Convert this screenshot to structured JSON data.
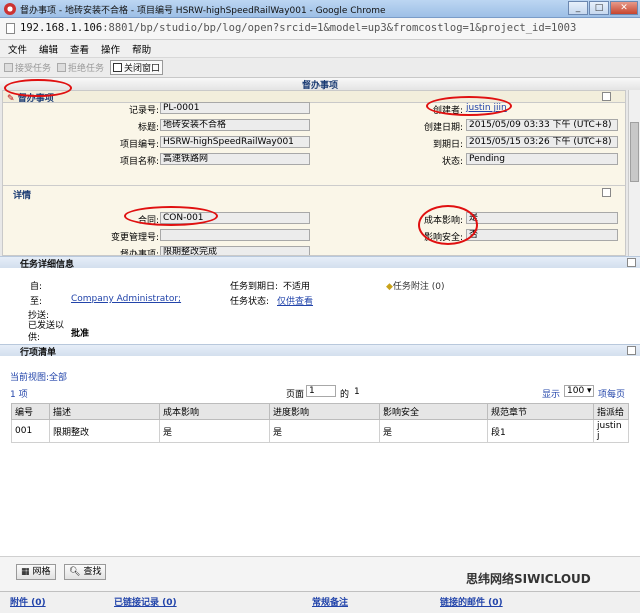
{
  "window": {
    "title": "督办事项 - 地砖安装不合格 - 项目编号 HSRW-highSpeedRailWay001 - Google Chrome",
    "address": "192.168.1.106",
    "address_path": ":8801/bp/studio/bp/log/open?srcid=1&model=up3&fromcostlog=1&project_id=1003"
  },
  "menu": [
    "文件",
    "编辑",
    "查看",
    "操作",
    "帮助"
  ],
  "toolbar": {
    "accept": "接受任务",
    "reject": "拒绝任务",
    "close": "关闭窗口"
  },
  "page_title": "督办事项",
  "section1": {
    "title": "督办事项",
    "record_no_label": "记录号:",
    "record_no": "PL-0001",
    "subject_label": "标题:",
    "subject": "地砖安装不合格",
    "project_no_label": "项目编号:",
    "project_no": "HSRW-highSpeedRailWay001",
    "project_name_label": "项目名称:",
    "project_name": "高速铁路网",
    "creator_label": "创建者:",
    "creator": "justin jiin",
    "created_label": "创建日期:",
    "created": "2015/05/09 03:33 下午 (UTC+8)",
    "due_label": "到期日:",
    "due": "2015/05/15 03:26 下午 (UTC+8)",
    "status_label": "状态:",
    "status": "Pending"
  },
  "details": {
    "title": "详情",
    "contract_label": "合同:",
    "contract": "CON-001",
    "change_label": "变更管理号:",
    "change": "",
    "supervise_label": "督办事项:",
    "supervise": "限期整改完成",
    "cost_label": "成本影响:",
    "cost": "是",
    "safety_label": "影响安全:",
    "safety": "否"
  },
  "task": {
    "title": "任务详细信息",
    "from_label": "自:",
    "to_label": "至:",
    "to": "Company Administrator;",
    "cc_label": "抄送:",
    "sent_label": "已发送以供:",
    "sent": "批准",
    "due_label": "任务到期日:",
    "due": "不适用",
    "state_label": "任务状态:",
    "state": "仅供查看",
    "note": "任务附注 (0)"
  },
  "items": {
    "title": "行项清单",
    "view_label": "当前视图:",
    "view": "全部",
    "count": "1 项",
    "page_label": "页面",
    "page": "1",
    "of": "的",
    "total": "1",
    "show_label": "显示",
    "show": "100",
    "per_page": "项每页",
    "columns": [
      "编号",
      "描述",
      "成本影响",
      "进度影响",
      "影响安全",
      "规范章节",
      "指派给"
    ],
    "rows": [
      [
        "001",
        "限期整改",
        "是",
        "是",
        "是",
        "段1",
        "justin j"
      ]
    ]
  },
  "buttons": {
    "grid": "网格",
    "find": "查找"
  },
  "statusbar": {
    "attachments": "附件 (0)",
    "linked_records": "已链接记录 (0)",
    "notes": "常规备注",
    "linked_mail": "链接的邮件 (0)"
  },
  "watermark": "思纬网络SIWICLOUD"
}
